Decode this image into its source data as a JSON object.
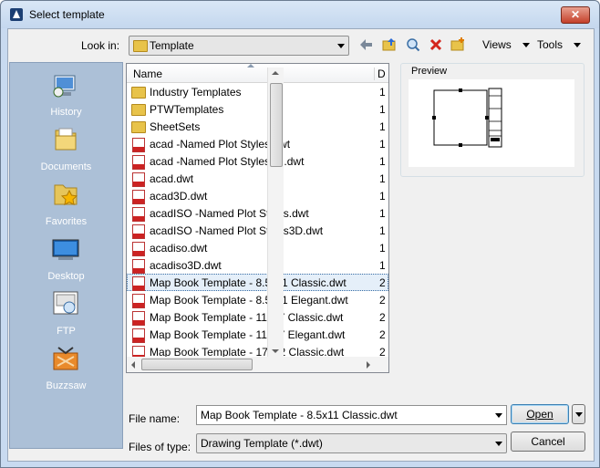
{
  "window": {
    "title": "Select template"
  },
  "toolbar": {
    "look_in_label": "Look in:",
    "look_in_value": "Template",
    "views_label": "Views",
    "tools_label": "Tools"
  },
  "places": [
    {
      "label": "History",
      "icon": "history-icon"
    },
    {
      "label": "Documents",
      "icon": "documents-icon"
    },
    {
      "label": "Favorites",
      "icon": "favorites-icon"
    },
    {
      "label": "Desktop",
      "icon": "desktop-icon"
    },
    {
      "label": "FTP",
      "icon": "ftp-icon"
    },
    {
      "label": "Buzzsaw",
      "icon": "buzzsaw-icon"
    }
  ],
  "filelist": {
    "column_name": "Name",
    "column_date": "D",
    "rows": [
      {
        "name": "Industry Templates",
        "type": "folder",
        "date": "1"
      },
      {
        "name": "PTWTemplates",
        "type": "folder",
        "date": "1"
      },
      {
        "name": "SheetSets",
        "type": "folder",
        "date": "1"
      },
      {
        "name": "acad -Named Plot Styles.dwt",
        "type": "dwt",
        "date": "1"
      },
      {
        "name": "acad -Named Plot Styles3D.dwt",
        "type": "dwt",
        "date": "1"
      },
      {
        "name": "acad.dwt",
        "type": "dwt",
        "date": "1"
      },
      {
        "name": "acad3D.dwt",
        "type": "dwt",
        "date": "1"
      },
      {
        "name": "acadISO -Named Plot Styles.dwt",
        "type": "dwt",
        "date": "1"
      },
      {
        "name": "acadISO -Named Plot Styles3D.dwt",
        "type": "dwt",
        "date": "1"
      },
      {
        "name": "acadiso.dwt",
        "type": "dwt",
        "date": "1"
      },
      {
        "name": "acadiso3D.dwt",
        "type": "dwt",
        "date": "1"
      },
      {
        "name": "Map Book Template - 8.5x11 Classic.dwt",
        "type": "dwt",
        "date": "2",
        "selected": true
      },
      {
        "name": "Map Book Template - 8.5x11 Elegant.dwt",
        "type": "dwt",
        "date": "2"
      },
      {
        "name": "Map Book Template - 11x17 Classic.dwt",
        "type": "dwt",
        "date": "2"
      },
      {
        "name": "Map Book Template - 11x17 Elegant.dwt",
        "type": "dwt",
        "date": "2"
      },
      {
        "name": "Map Book Template - 17x22 Classic.dwt",
        "type": "dwt",
        "date": "2"
      }
    ]
  },
  "preview": {
    "label": "Preview"
  },
  "form": {
    "file_name_label": "File name:",
    "file_name_value": "Map Book Template - 8.5x11 Classic.dwt",
    "files_of_type_label": "Files of type:",
    "files_of_type_value": "Drawing Template (*.dwt)"
  },
  "buttons": {
    "open": "Open",
    "cancel": "Cancel"
  }
}
